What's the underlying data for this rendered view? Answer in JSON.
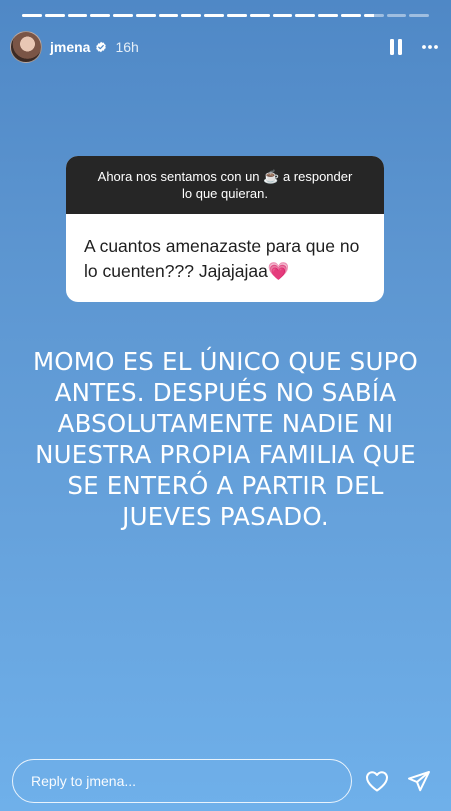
{
  "progress": {
    "segment_count": 18,
    "completed": 15,
    "current_fraction": 0.5
  },
  "header": {
    "username": "jmena",
    "verified": true,
    "time_ago": "16h",
    "icons": [
      "pause-icon",
      "more-icon"
    ]
  },
  "question": {
    "prompt": "Ahora nos sentamos con un ☕ a responder lo que quieran.",
    "answer": "A cuantos amenazaste para que no lo cuenten??? Jajajajaa💗"
  },
  "story_text": "MOMO ES EL ÚNICO QUE SUPO ANTES. DESPUÉS NO SABÍA ABSOLUTAMENTE NADIE NI NUESTRA PROPIA FAMILIA QUE SE ENTERÓ A PARTIR DEL JUEVES PASADO.",
  "footer": {
    "reply_placeholder": "Reply to jmena...",
    "icons": [
      "heart-icon",
      "send-icon"
    ]
  },
  "colors": {
    "background_top": "#4f88c6",
    "background_bottom": "#6fb0ea",
    "prompt_bg": "#262626",
    "verified": "#ffffff"
  }
}
